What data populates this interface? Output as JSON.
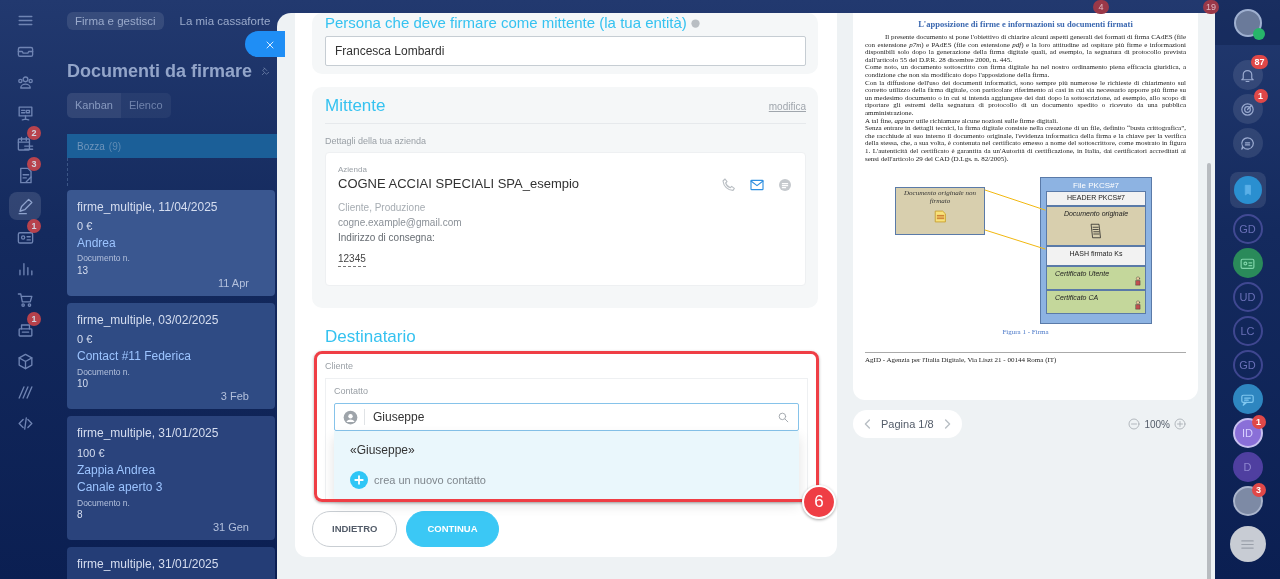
{
  "left_rail": [
    {
      "kind": "menu",
      "selected": false
    },
    {
      "kind": "tray",
      "selected": false
    },
    {
      "kind": "people",
      "selected": false
    },
    {
      "kind": "board",
      "selected": false
    },
    {
      "kind": "calendar",
      "selected": false,
      "badge": "2"
    },
    {
      "kind": "document",
      "selected": false,
      "badge": "3"
    },
    {
      "kind": "pen",
      "selected": true
    },
    {
      "kind": "idcard",
      "selected": false,
      "badge": "1"
    },
    {
      "kind": "chart",
      "selected": false
    },
    {
      "kind": "cart",
      "selected": false
    },
    {
      "kind": "register",
      "selected": false,
      "badge": "1"
    },
    {
      "kind": "cube",
      "selected": false
    },
    {
      "kind": "stripes",
      "selected": false
    },
    {
      "kind": "code",
      "selected": false
    }
  ],
  "top_tabs": [
    {
      "label": "Firma e gestisci",
      "selected": true
    },
    {
      "label": "La mia cassaforte",
      "selected": false
    }
  ],
  "top_counters": [
    "4",
    "19"
  ],
  "page_title": "Documenti da firmare",
  "view_toggle": [
    {
      "label": "Kanban",
      "selected": true
    },
    {
      "label": "Elenco",
      "selected": false
    }
  ],
  "kanban_column": {
    "title": "Bozza",
    "count": "(9)"
  },
  "cards": [
    {
      "title": "firme_multiple, 11/04/2025",
      "amount": "0 €",
      "contacts": [
        "Andrea"
      ],
      "doc_label": "Documento n.",
      "doc_number": "13",
      "date": "11 Apr"
    },
    {
      "title": "firme_multiple, 03/02/2025",
      "amount": "0 €",
      "contacts": [
        "Contact #11 Federica"
      ],
      "doc_label": "Documento n.",
      "doc_number": "10",
      "date": "3 Feb"
    },
    {
      "title": "firme_multiple, 31/01/2025",
      "amount": "100 €",
      "contacts": [
        "Zappia Andrea",
        "Canale aperto 3"
      ],
      "doc_label": "Documento n.",
      "doc_number": "8",
      "date": "31 Gen"
    },
    {
      "title": "firme_multiple, 31/01/2025"
    }
  ],
  "form": {
    "signer": {
      "title": "Persona che deve firmare come mittente (la tua entità)",
      "value": "Francesca Lombardi"
    },
    "sender": {
      "title": "Mittente",
      "edit_link": "modifica",
      "caption": "Dettagli della tua azienda",
      "company_label": "Azienda",
      "company_name": "COGNE ACCIAI SPECIALI SPA_esempio",
      "tags": "Cliente, Produzione",
      "email": "cogne.example@gmail.com",
      "address_label": "Indirizzo di consegna:",
      "address": "12345"
    },
    "recipient": {
      "title": "Destinatario",
      "client_label": "Cliente",
      "contact_label": "Contatto",
      "search_value": "Giuseppe",
      "suggestions": [
        {
          "kind": "match",
          "label": "«Giuseppe»"
        },
        {
          "kind": "create",
          "label": "crea un nuovo contatto"
        }
      ]
    },
    "buttons": [
      {
        "kind": "secondary",
        "label": "INDIETRO"
      },
      {
        "kind": "primary",
        "label": "CONTINUA"
      }
    ]
  },
  "annotation": {
    "label": "6"
  },
  "preview": {
    "title": "L'apposizione di firme e informazioni su documenti firmati",
    "paragraphs": [
      "Il presente documento si pone l'obiettivo di chiarire alcuni aspetti generali dei formati di firma CAdES (file con estensione *p7m*) e PAdES (file con estensione *pdf*) e la loro attitudine ad ospitare più firme e informazioni disponibili solo dopo la generazione della firma digitale quali, ad esempio, la segnatura di protocollo prevista dall'articolo 55 del D.P.R. 28 dicembre 2000, n. 445.",
      "Come noto, un documento sottoscritto con firma digitale ha nel nostro ordinamento piena efficacia giuridica, a condizione che non sia modificato dopo l'apposizione della firma.",
      "Con la diffusione dell'uso dei documenti informatici, sono sempre più numerose le richieste di chiarimento sul corretto utilizzo della firma digitale, con particolare riferimento ai casi in cui sia necessario apporre più firme su un medesimo documento o in cui si intenda aggiungere dei dati dopo la sottoscrizione, ad esempio, allo scopo di riportare gli estremi della segnatura di protocollo di un documento spedito o ricevuto da una pubblica amministrazione.",
      "A tal fine, *appare* utile richiamare alcune nozioni sulle firme digitali.",
      "Senza entrare in dettagli tecnici, la firma digitale consiste nella creazione di un file, definito “busta crittografica”, che racchiude al suo interno il documento originale, l'evidenza informatica della firma e la chiave per la verifica della stessa, che, a sua volta, è contenuta nel certificato emesso a nome del sottoscrittore, come mostrato in figura 1. L'autenticità del certificato è garantita da un'Autorità di certificazione, in Italia, dai certificatori accreditati ai sensi dell'articolo 29 del CAD (D.Lgs. n. 82/2005)."
    ],
    "diagram": {
      "source_label": "Documento originale non firmato",
      "container_title": "File PKCS#7",
      "rows": [
        {
          "kind": "header",
          "label": "HEADER PKCS#7"
        },
        {
          "kind": "document",
          "label": "Documento originale"
        },
        {
          "kind": "hash",
          "label": "HASH firmato Ks"
        },
        {
          "kind": "certificate",
          "label": "Certificato Utente"
        },
        {
          "kind": "certificate",
          "label": "Certificato CA"
        }
      ]
    },
    "caption": "Figura 1 - Firma",
    "footer": "AgID - Agenzia per l'Italia Digitale, Via Liszt 21 - 00144 Roma (IT)"
  },
  "pager": {
    "label": "Pagina 1/8",
    "zoom": "100%"
  },
  "right_rail": [
    {
      "kind": "bell",
      "badge": "87"
    },
    {
      "kind": "target",
      "badge": "1"
    },
    {
      "kind": "chat"
    },
    {
      "kind": "bookmark"
    },
    {
      "kind": "initials",
      "text": "GD",
      "filled": false
    },
    {
      "kind": "idcard"
    },
    {
      "kind": "initials",
      "text": "UD",
      "filled": false
    },
    {
      "kind": "initials",
      "text": "LC",
      "filled": false
    },
    {
      "kind": "initials",
      "text": "GD",
      "filled": false
    },
    {
      "kind": "chatbot"
    },
    {
      "kind": "initials",
      "text": "ID",
      "filled": true,
      "badge": "1"
    },
    {
      "kind": "initials",
      "text": "D",
      "filled": true
    },
    {
      "kind": "photo",
      "badge": "3"
    },
    {
      "kind": "menu"
    }
  ]
}
